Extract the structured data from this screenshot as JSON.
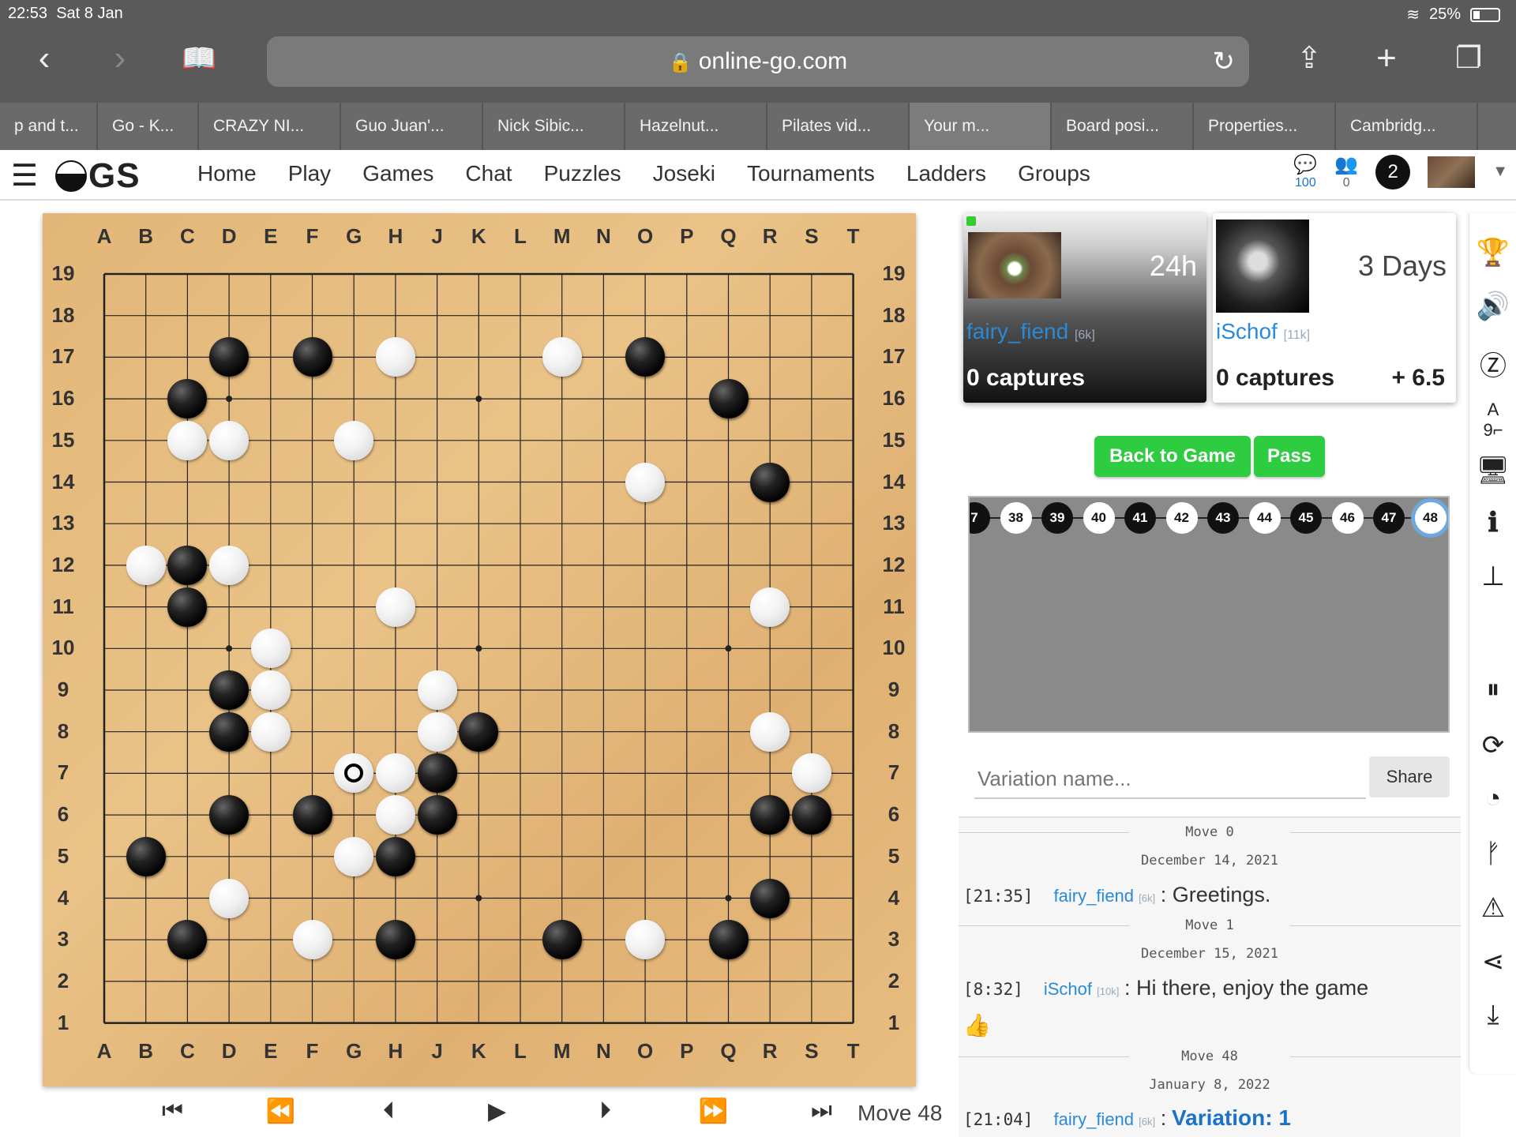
{
  "status": {
    "time": "22:53",
    "date": "Sat 8 Jan",
    "battery": "25%"
  },
  "browser": {
    "url": "online-go.com",
    "icons": {
      "back": "chevron-left-icon",
      "forward": "chevron-right-icon",
      "bookmarks": "book-icon",
      "reload": "reload-icon",
      "share": "share-icon",
      "newtab": "plus-icon",
      "tabs": "tabs-icon"
    }
  },
  "tabs": [
    "p and t...",
    "Go - K...",
    "CRAZY NI...",
    "Guo Juan'...",
    "Nick Sibic...",
    "Hazelnut...",
    "Pilates vid...",
    "Your m...",
    "Board posi...",
    "Properties...",
    "Cambridg..."
  ],
  "ogs": {
    "logo": "GS",
    "menu": [
      "Home",
      "Play",
      "Games",
      "Chat",
      "Puzzles",
      "Joseki",
      "Tournaments",
      "Ladders",
      "Groups"
    ],
    "chat_count": "100",
    "friends_count": "0",
    "notifications": "2"
  },
  "board": {
    "columns": [
      "A",
      "B",
      "C",
      "D",
      "E",
      "F",
      "G",
      "H",
      "J",
      "K",
      "L",
      "M",
      "N",
      "O",
      "P",
      "Q",
      "R",
      "S",
      "T"
    ],
    "rows": [
      "19",
      "18",
      "17",
      "16",
      "15",
      "14",
      "13",
      "12",
      "11",
      "10",
      "9",
      "8",
      "7",
      "6",
      "5",
      "4",
      "3",
      "2",
      "1"
    ],
    "black": [
      "D17",
      "F17",
      "O17",
      "C16",
      "Q16",
      "R14",
      "C12",
      "C11",
      "D9",
      "D8",
      "K8",
      "J7",
      "J6",
      "D6",
      "F6",
      "R6",
      "S6",
      "B5",
      "H5",
      "R4",
      "C3",
      "H3",
      "M3",
      "Q3"
    ],
    "white": [
      "H17",
      "M17",
      "C15",
      "D15",
      "G15",
      "O14",
      "B12",
      "D12",
      "H11",
      "R11",
      "E10",
      "E9",
      "J9",
      "E8",
      "J8",
      "R8",
      "H7",
      "S7",
      "H6",
      "G5",
      "D4",
      "F3",
      "O3"
    ],
    "last_move": "G7"
  },
  "controls": {
    "icons": [
      "skip-to-start-icon",
      "fast-back-icon",
      "step-back-icon",
      "play-icon",
      "step-forward-icon",
      "fast-forward-icon",
      "skip-to-end-icon"
    ],
    "move_label": "Move 48"
  },
  "players": {
    "black": {
      "name": "fairy_fiend",
      "rank": "[6k]",
      "clock": "24h",
      "captures": "0 captures"
    },
    "white": {
      "name": "iSchof",
      "rank": "[11k]",
      "clock": "3 Days",
      "captures": "0 captures",
      "komi": "+ 6.5"
    }
  },
  "actions": {
    "back_to_game": "Back to Game",
    "pass": "Pass"
  },
  "move_tree": {
    "moves": [
      {
        "n": "7",
        "c": "b"
      },
      {
        "n": "38",
        "c": "w"
      },
      {
        "n": "39",
        "c": "b"
      },
      {
        "n": "40",
        "c": "w"
      },
      {
        "n": "41",
        "c": "b"
      },
      {
        "n": "42",
        "c": "w"
      },
      {
        "n": "43",
        "c": "b"
      },
      {
        "n": "44",
        "c": "w"
      },
      {
        "n": "45",
        "c": "b"
      },
      {
        "n": "46",
        "c": "w"
      },
      {
        "n": "47",
        "c": "b"
      },
      {
        "n": "48",
        "c": "w"
      }
    ],
    "selected": "48"
  },
  "variation": {
    "placeholder": "Variation name...",
    "share": "Share"
  },
  "chat": {
    "entries": [
      {
        "move": "Move 0",
        "date": "December 14, 2021",
        "time": "[21:35]",
        "user": "fairy_fiend",
        "rank": "[6k]",
        "message": ": Greetings."
      },
      {
        "move": "Move 1",
        "date": "December 15, 2021",
        "time": "[8:32]",
        "user": "iSchof",
        "rank": "[10k]",
        "message": ": Hi there, enjoy the game"
      },
      {
        "move": "Move 48",
        "date": "January 8, 2022",
        "time": "[21:04]",
        "user": "fairy_fiend",
        "rank": "[6k]",
        "message": ":",
        "variation": "Variation: 1"
      }
    ],
    "reaction": "👍"
  },
  "dock": [
    "trophy-icon",
    "speaker-icon",
    "zen-mode-icon",
    "coordinates-icon",
    "monitor-icon",
    "info-icon",
    "tree-icon",
    "pause-icon",
    "refresh-icon",
    "analyze-icon",
    "fork-icon",
    "warning-icon",
    "share-icon",
    "download-icon"
  ]
}
